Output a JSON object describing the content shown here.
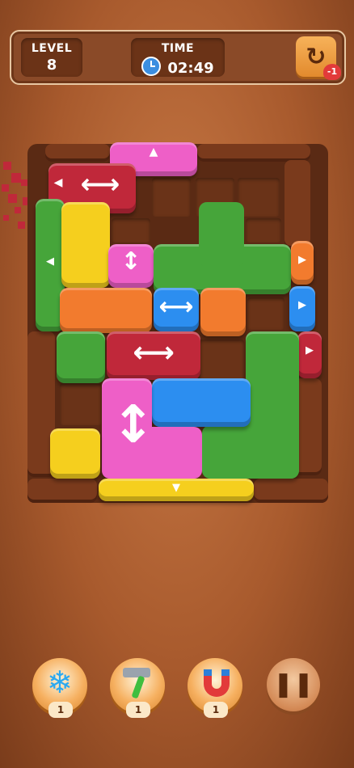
{
  "hud": {
    "level_label": "LEVEL",
    "level_value": "8",
    "time_label": "TIME",
    "time_value": "02:49",
    "restart_cost": "-1"
  },
  "icons": {
    "clock": "clock-icon",
    "restart": "restart-icon",
    "heart": "heart-icon",
    "freeze": "snowflake-icon",
    "hammer": "hammer-icon",
    "magnet": "magnet-icon",
    "pause": "pause-icon"
  },
  "colors": {
    "red": "#c0283a",
    "pink": "#ee5fc7",
    "green": "#46a53a",
    "yellow": "#f5cf1e",
    "orange": "#f27b2e",
    "blue": "#2c8ef0"
  },
  "boosters": [
    {
      "name": "freeze",
      "count": "1"
    },
    {
      "name": "hammer",
      "count": "1"
    },
    {
      "name": "magnet",
      "count": "1"
    }
  ]
}
